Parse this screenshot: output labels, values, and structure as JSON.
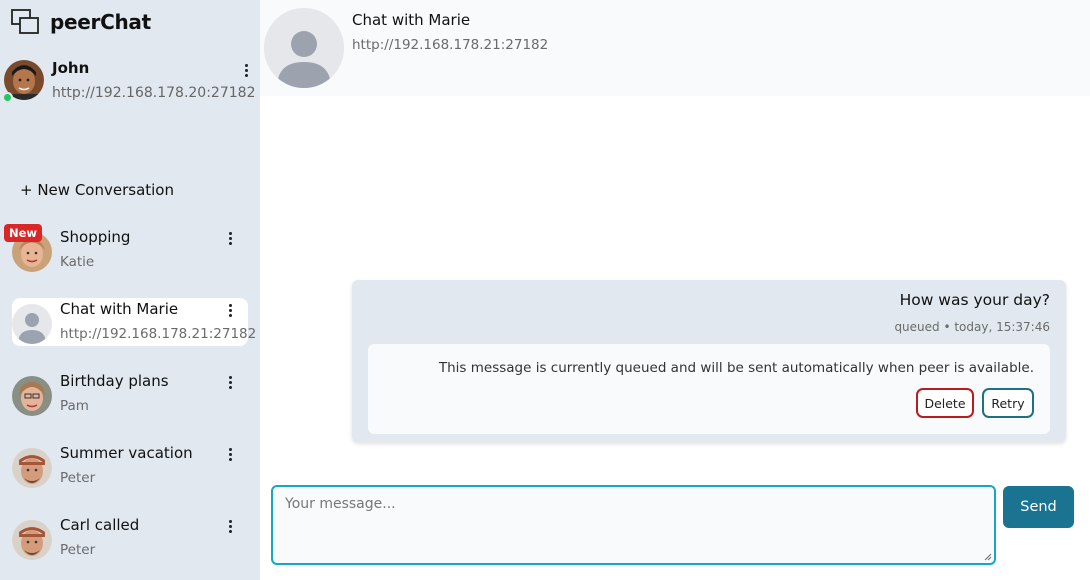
{
  "app": {
    "name": "peerChat"
  },
  "user": {
    "name": "John",
    "address": "http://192.168.178.20:27182",
    "status": "online"
  },
  "sidebar": {
    "new_conversation_label": "+ New Conversation",
    "new_badge": "New",
    "conversations": [
      {
        "title": "Shopping",
        "subtitle": "Katie",
        "is_new": true
      },
      {
        "title": "Chat with Marie",
        "subtitle": "http://192.168.178.21:27182",
        "active": true
      },
      {
        "title": "Birthday plans",
        "subtitle": "Pam"
      },
      {
        "title": "Summer vacation",
        "subtitle": "Peter"
      },
      {
        "title": "Carl called",
        "subtitle": "Peter"
      }
    ]
  },
  "chat": {
    "title": "Chat with Marie",
    "address": "http://192.168.178.21:27182",
    "messages": [
      {
        "text": "How was your day?",
        "meta": "queued • today, 15:37:46",
        "notice": "This message is currently queued and will be sent automatically when peer is available.",
        "delete_label": "Delete",
        "retry_label": "Retry"
      }
    ]
  },
  "composer": {
    "placeholder": "Your message...",
    "send_label": "Send"
  },
  "colors": {
    "sidebar_bg": "#e2e8f0",
    "accent": "#1a7390",
    "focus_border": "#14a8c2",
    "new_badge": "#dc2626",
    "online": "#22c55e",
    "delete_border": "#b91c1c"
  }
}
